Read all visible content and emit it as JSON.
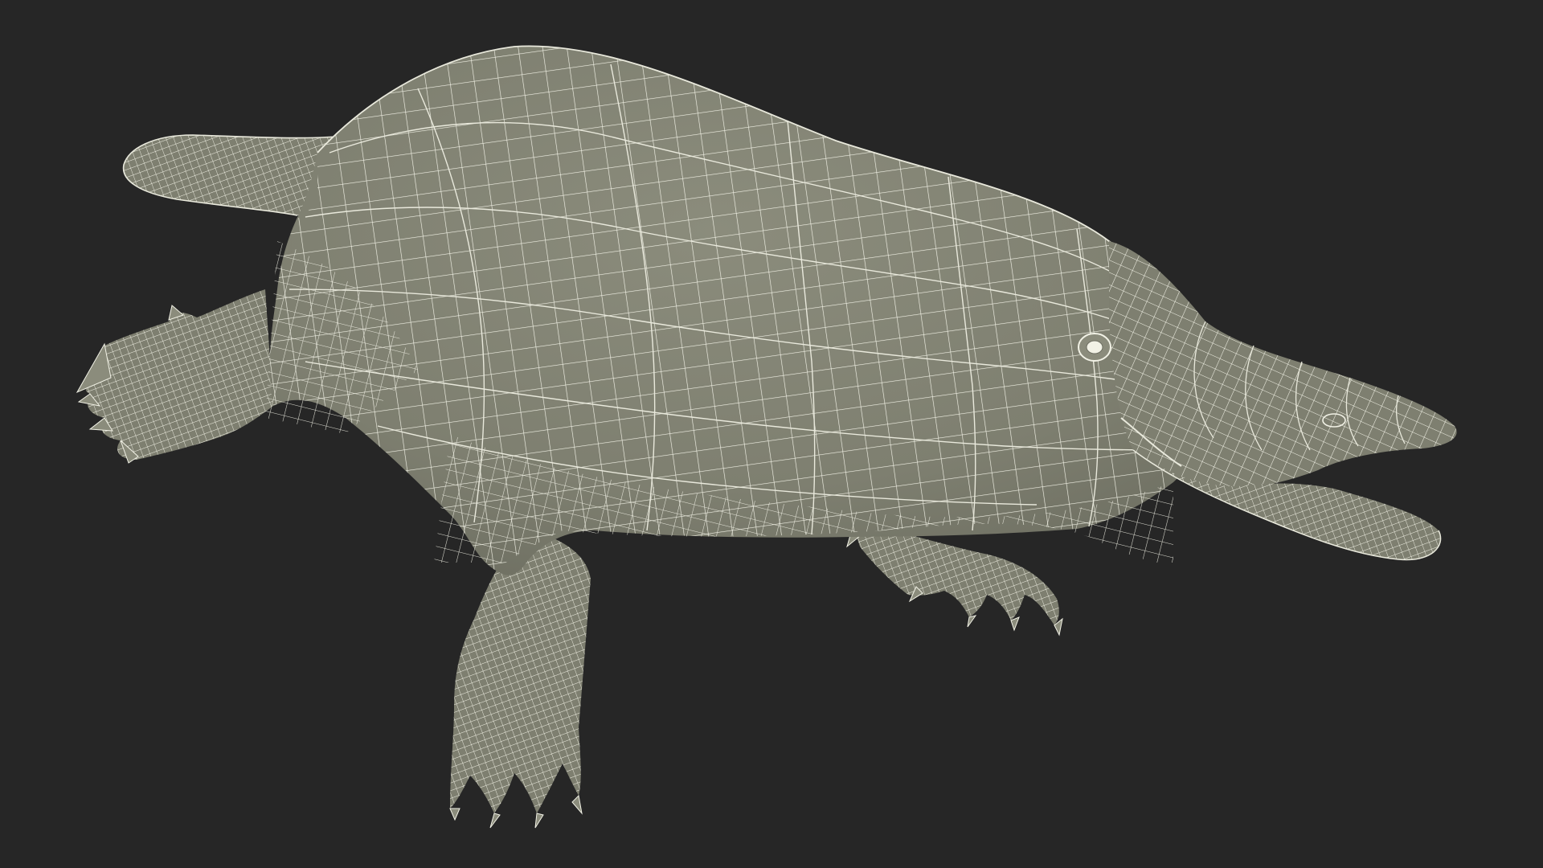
{
  "scene": {
    "subject": "platypus-wireframe-mesh",
    "colors": {
      "background": "#262626",
      "mesh_fill": "#7e7f70",
      "mesh_fill_shadow": "#6c6d60",
      "mesh_fill_light": "#8b8c7c",
      "wire": "#f2f2e6",
      "wire_dense": "#e9e9dc"
    }
  }
}
